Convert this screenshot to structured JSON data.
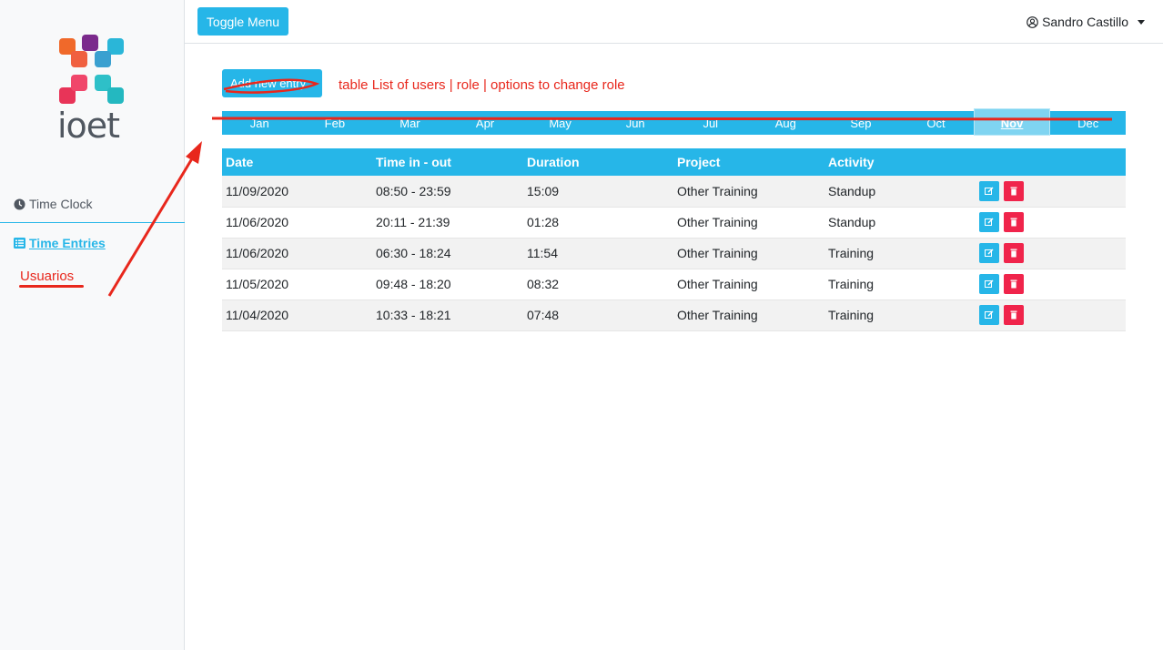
{
  "sidebar": {
    "logo_text": "ioet",
    "items": [
      {
        "label": "Time Clock",
        "icon": "clock-icon"
      },
      {
        "label": "Time Entries",
        "icon": "list-icon"
      }
    ],
    "annotation_label": "Usuarios"
  },
  "header": {
    "toggle_label": "Toggle Menu",
    "user_name": "Sandro Castillo"
  },
  "main": {
    "add_entry_label": "Add new entry",
    "annotation": "table List of users | role | options to change  role",
    "months": [
      "Jan",
      "Feb",
      "Mar",
      "Apr",
      "May",
      "Jun",
      "Jul",
      "Aug",
      "Sep",
      "Oct",
      "Nov",
      "Dec"
    ],
    "active_month": "Nov",
    "table": {
      "headers": [
        "Date",
        "Time in - out",
        "Duration",
        "Project",
        "Activity"
      ],
      "rows": [
        {
          "date": "11/09/2020",
          "time": "08:50 - 23:59",
          "duration": "15:09",
          "project": "Other Training",
          "activity": "Standup"
        },
        {
          "date": "11/06/2020",
          "time": "20:11 - 21:39",
          "duration": "01:28",
          "project": "Other Training",
          "activity": "Standup"
        },
        {
          "date": "11/06/2020",
          "time": "06:30 - 18:24",
          "duration": "11:54",
          "project": "Other Training",
          "activity": "Training"
        },
        {
          "date": "11/05/2020",
          "time": "09:48 - 18:20",
          "duration": "08:32",
          "project": "Other Training",
          "activity": "Training"
        },
        {
          "date": "11/04/2020",
          "time": "10:33 - 18:21",
          "duration": "07:48",
          "project": "Other Training",
          "activity": "Training"
        }
      ]
    }
  },
  "colors": {
    "accent": "#26b6e8",
    "danger": "#f0244b",
    "annotation": "#e8271c"
  }
}
